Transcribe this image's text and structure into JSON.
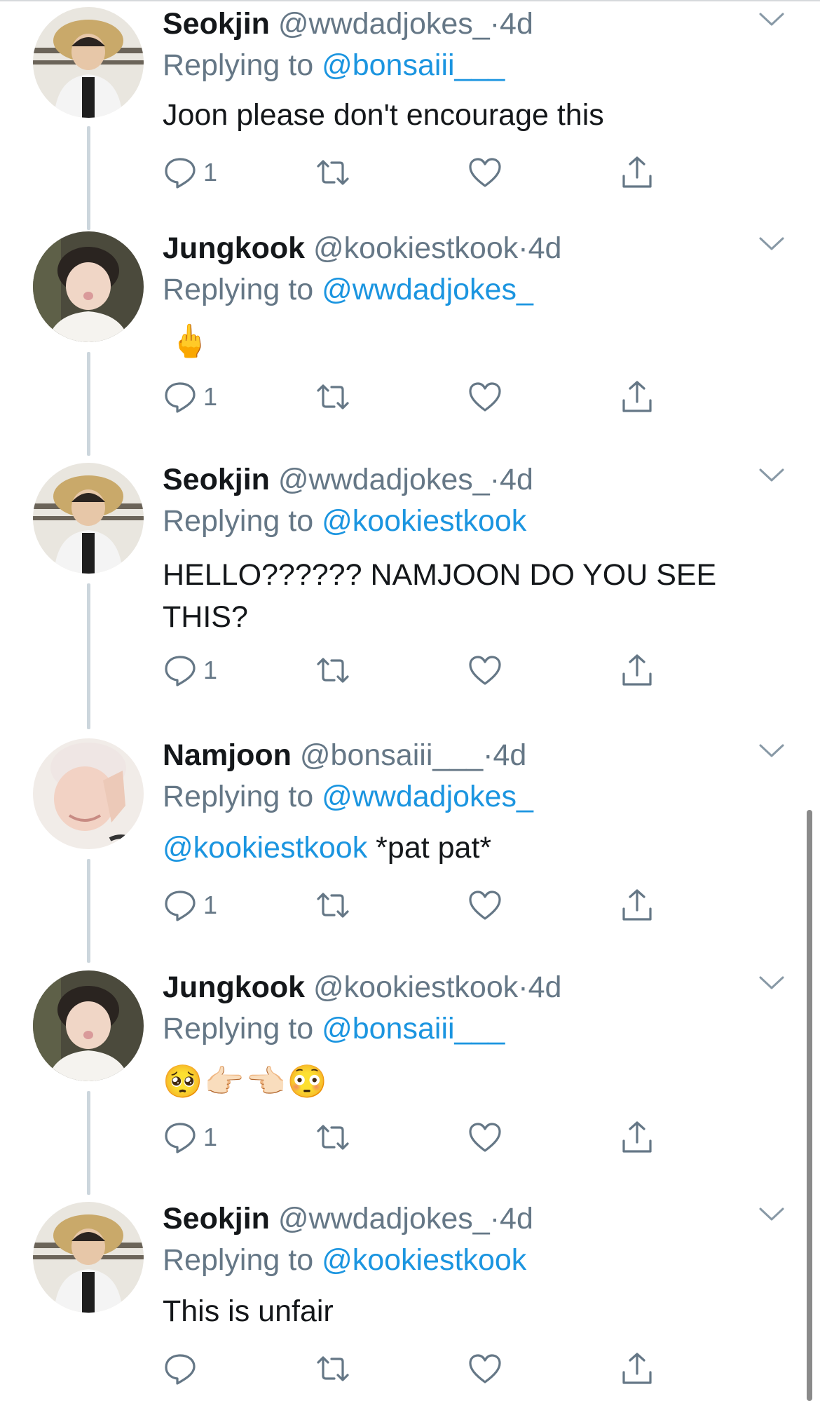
{
  "tweets": [
    {
      "name": "Seokjin",
      "handle": "@wwdadjokes_",
      "dot": "·",
      "time": "4d",
      "replying_prefix": "Replying to ",
      "replying_to": "@bonsaiii___",
      "text": "Joon please don't encourage this",
      "reply_count": "1",
      "avatar": "seokjin-avatar"
    },
    {
      "name": "Jungkook",
      "handle": "@kookiestkook",
      "dot": "·",
      "time": "4d",
      "replying_prefix": "Replying to ",
      "replying_to": "@wwdadjokes_",
      "emoji": "🖕",
      "reply_count": "1",
      "avatar": "jungkook-avatar"
    },
    {
      "name": "Seokjin",
      "handle": "@wwdadjokes_",
      "dot": "·",
      "time": "4d",
      "replying_prefix": "Replying to ",
      "replying_to": "@kookiestkook",
      "text": "HELLO?????? NAMJOON DO YOU SEE THIS?",
      "reply_count": "1",
      "avatar": "seokjin-avatar"
    },
    {
      "name": "Namjoon",
      "handle": "@bonsaiii___",
      "dot": "·",
      "time": "4d",
      "replying_prefix": "Replying to ",
      "replying_to": "@wwdadjokes_",
      "text_mention": "@kookiestkook",
      "text": " *pat pat*",
      "reply_count": "1",
      "avatar": "namjoon-avatar"
    },
    {
      "name": "Jungkook",
      "handle": "@kookiestkook",
      "dot": "·",
      "time": "4d",
      "replying_prefix": "Replying to ",
      "replying_to": "@bonsaiii___",
      "emoji": "🥺👉🏻👈🏻😳",
      "reply_count": "1",
      "avatar": "jungkook-avatar"
    },
    {
      "name": "Seokjin",
      "handle": "@wwdadjokes_",
      "dot": "·",
      "time": "4d",
      "replying_prefix": "Replying to ",
      "replying_to": "@kookiestkook",
      "text": "This is unfair",
      "reply_count": "",
      "avatar": "seokjin-avatar"
    }
  ],
  "icons": {
    "reply": "reply-icon",
    "retweet": "retweet-icon",
    "like": "like-icon",
    "share": "share-icon",
    "more": "chevron-down-icon"
  },
  "colors": {
    "link": "#1b95e0",
    "secondary": "#657786",
    "text": "#14171a",
    "thread": "#ccd6dd"
  }
}
